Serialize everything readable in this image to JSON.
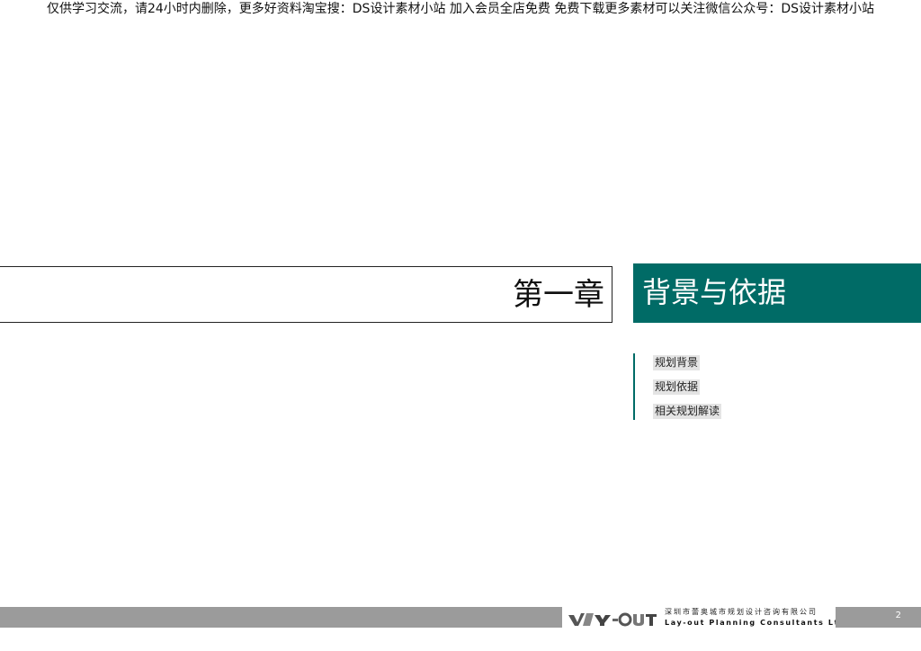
{
  "watermark": "仅供学习交流，请24小时内删除，更多好资料淘宝搜：DS设计素材小站  加入会员全店免费  免费下载更多素材可以关注微信公众号：DS设计素材小站",
  "chapter": {
    "label": "第一章",
    "title": "背景与依据"
  },
  "toc": {
    "items": [
      "规划背景",
      "规划依据",
      "相关规划解读"
    ]
  },
  "footer": {
    "logo_text": "LAY-OUT",
    "company_cn": "深圳市蕾奥城市规划设计咨询有限公司",
    "company_en": "Lay-out Planning Consultants Ltd",
    "page_number": "2"
  },
  "colors": {
    "accent": "#006b66",
    "footer_gray": "#9b9b9b"
  }
}
